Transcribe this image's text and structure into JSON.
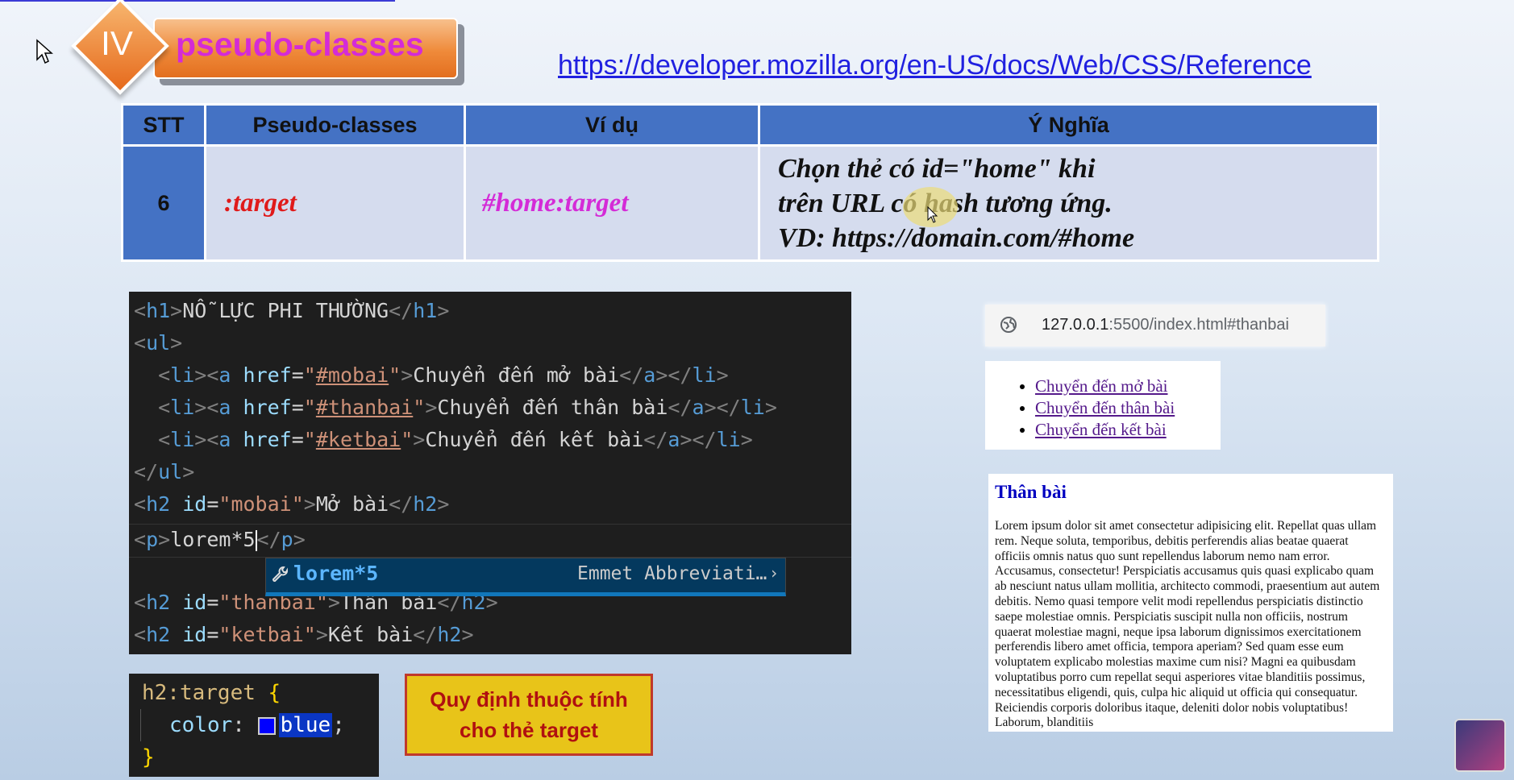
{
  "header": {
    "section_number": "IV",
    "title": "pseudo-classes",
    "reference_link": "https://developer.mozilla.org/en-US/docs/Web/CSS/Reference"
  },
  "table": {
    "headers": [
      "STT",
      "Pseudo-classes",
      "Ví dụ",
      "Ý Nghĩa"
    ],
    "row": {
      "stt": "6",
      "pseudo_class": ":target",
      "example": "#home:target",
      "meaning_lines": [
        "Chọn thẻ có id=\"home\" khi",
        "trên URL có hash tương ứng.",
        "VD: https://domain.com/#home"
      ]
    }
  },
  "code_editor": {
    "lines": [
      "<h1>NỖ LỰC PHI THƯỜNG</h1>",
      "<ul>",
      "  <li><a href=\"#mobai\">Chuyển đến mở bài</a></li>",
      "  <li><a href=\"#thanbai\">Chuyển đến thân bài</a></li>",
      "  <li><a href=\"#ketbai\">Chuyển đến kết bài</a></li>",
      "</ul>",
      "<h2 id=\"mobai\">Mở bài</h2>",
      "<p>lorem*5</p>",
      "<h2 id=\"thanbai\">Thân bài</h2>",
      "<h2 id=\"ketbai\">Kết bài</h2>"
    ],
    "suggestion": {
      "label": "lorem*5",
      "detail": "Emmet Abbreviati…",
      "icon": "wrench-icon"
    }
  },
  "css_snippet": {
    "selector": "h2:target",
    "property": "color",
    "value": "blue",
    "swatch_color": "#0000ff"
  },
  "note": {
    "line1": "Quy định thuộc tính",
    "line2": "cho thẻ target"
  },
  "browser": {
    "url_host": "127.0.0.1",
    "url_rest": ":5500/index.html#thanbai",
    "links": [
      "Chuyển đến mở bài",
      "Chuyển đến thân bài",
      "Chuyển đến kết bài"
    ],
    "heading": "Thân bài",
    "paragraph": "Lorem ipsum dolor sit amet consectetur adipisicing elit. Repellat quas ullam rem. Neque soluta, temporibus, debitis perferendis alias beatae quaerat officiis omnis natus quo sunt repellendus laborum nemo nam error. Accusamus, consectetur! Perspiciatis accusamus quis quasi explicabo quam ab nesciunt natus ullam mollitia, architecto commodi, praesentium aut autem debitis. Nemo quasi tempore velit modi repellendus perspiciatis distinctio saepe molestiae omnis. Perspiciatis suscipit nulla non officiis, nostrum quaerat molestiae magni, neque ipsa laborum dignissimos exercitationem perferendis libero amet officia, tempora aperiam? Sed quam esse eum voluptatem explicabo molestias maxime cum nisi? Magni ea quibusdam voluptatibus porro cum repellat sequi asperiores vitae blanditiis possimus, necessitatibus eligendi, quis, culpa hic aliquid ut officia qui consequatur. Reiciendis corporis doloribus itaque, deleniti dolor nobis voluptatibus! Laborum, blanditiis"
  },
  "colors": {
    "accent_orange": "#ef8a3a",
    "title_magenta": "#d42bd7",
    "table_header_blue": "#4472c4",
    "table_cell_lavender": "#d5dcee",
    "editor_bg": "#1e1e1e"
  }
}
